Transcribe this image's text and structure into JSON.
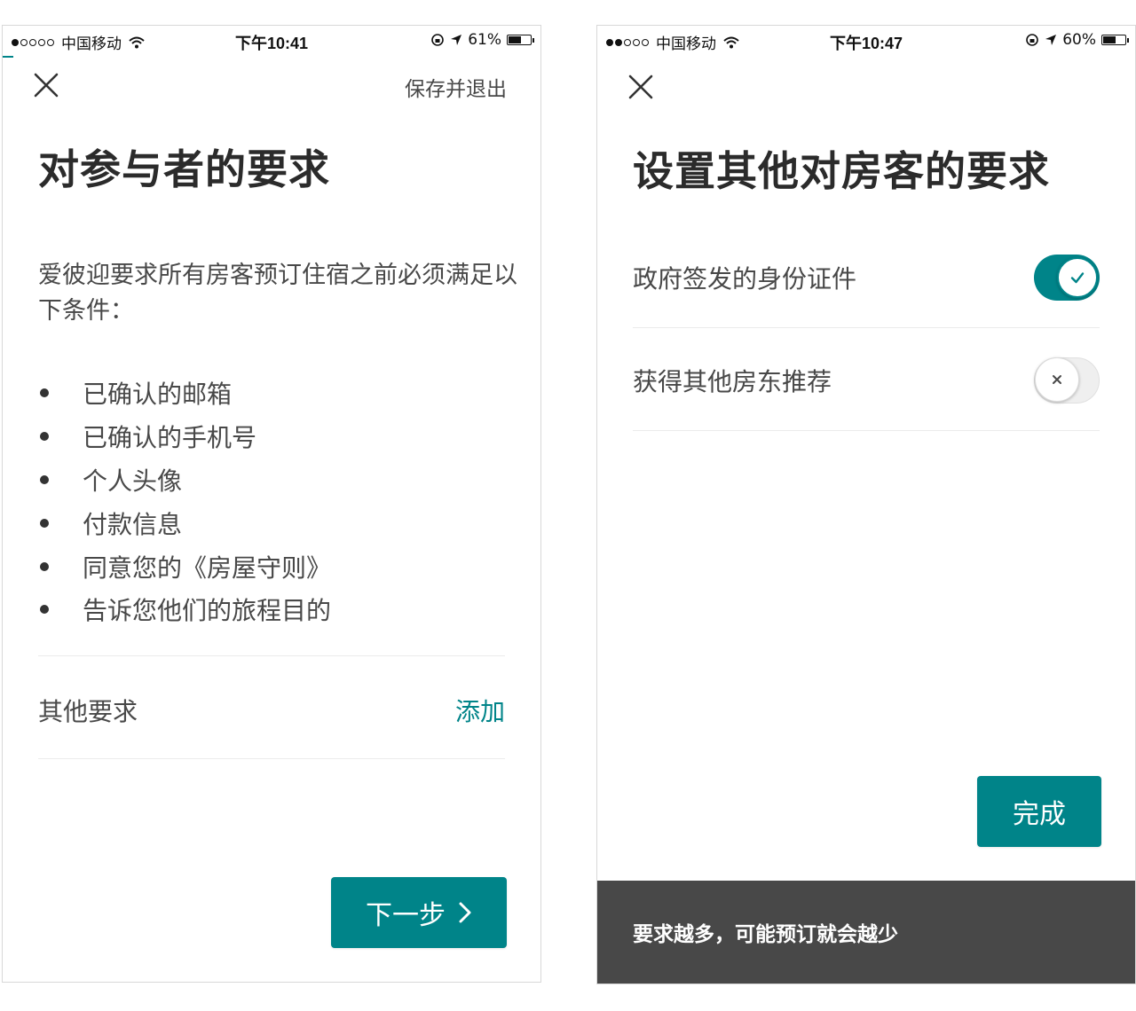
{
  "left_screen": {
    "status_bar": {
      "carrier": "中国移动",
      "time": "下午10:41",
      "battery": "61%",
      "battery_level": 0.61
    },
    "save_exit": "保存并退出",
    "title": "对参与者的要求",
    "intro": "爱彼迎要求所有房客预订住宿之前必须满足以下条件：",
    "requirements": [
      "已确认的邮箱",
      "已确认的手机号",
      "个人头像",
      "付款信息",
      "同意您的《房屋守则》",
      "告诉您他们的旅程目的"
    ],
    "other_label": "其他要求",
    "add_label": "添加",
    "next_label": "下一步"
  },
  "right_screen": {
    "status_bar": {
      "carrier": "中国移动",
      "time": "下午10:47",
      "battery": "60%",
      "battery_level": 0.6
    },
    "title": "设置其他对房客的要求",
    "toggles": [
      {
        "label": "政府签发的身份证件",
        "on": true
      },
      {
        "label": "获得其他房东推荐",
        "on": false
      }
    ],
    "done_label": "完成",
    "snackbar": "要求越多，可能预订就会越少"
  },
  "colors": {
    "accent": "#008489",
    "text": "#484848",
    "title": "#2b2b2b",
    "snackbar_bg": "#484848"
  },
  "icons": [
    "close-icon",
    "wifi-icon",
    "rotation-lock-icon",
    "location-arrow-icon",
    "battery-icon",
    "chevron-right-icon",
    "check-icon",
    "x-icon"
  ]
}
